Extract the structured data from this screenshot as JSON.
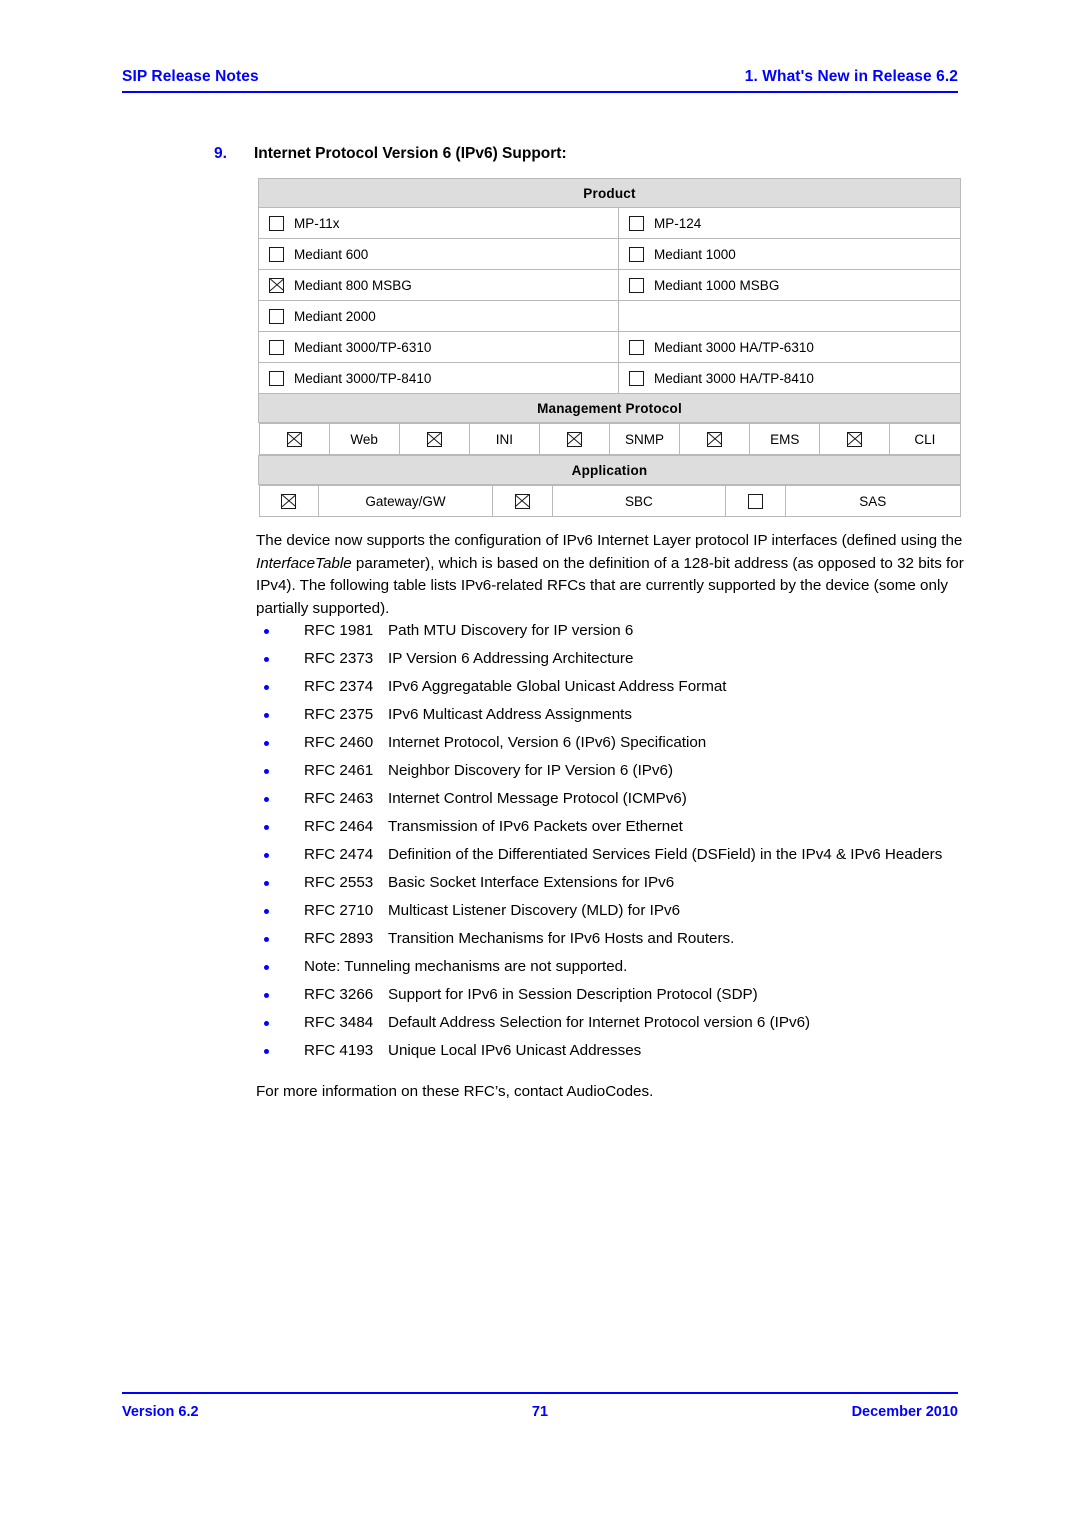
{
  "header": {
    "left": "SIP Release Notes",
    "right": "1. What's New in Release 6.2",
    "rule_color": "#0000FF"
  },
  "section": {
    "number": "9.",
    "title": "Internet Protocol Version 6 (IPv6) Support:",
    "number_color": "#0000FF"
  },
  "matrix": {
    "product": {
      "band_label": "Product",
      "rows": [
        {
          "left": {
            "label": "MP-11x",
            "checked": false
          },
          "right": {
            "label": "MP-124",
            "checked": false
          }
        },
        {
          "left": {
            "label": "Mediant 600",
            "checked": false
          },
          "right": {
            "label": "Mediant 1000",
            "checked": false
          }
        },
        {
          "left": {
            "label": "Mediant 800 MSBG",
            "checked": true
          },
          "right": {
            "label": "Mediant 1000 MSBG",
            "checked": false
          }
        },
        {
          "left": {
            "label": "Mediant 2000",
            "checked": false
          },
          "right": null
        },
        {
          "left": {
            "label": "Mediant 3000/TP-6310",
            "checked": false
          },
          "right": {
            "label": "Mediant 3000 HA/TP-6310",
            "checked": false
          }
        },
        {
          "left": {
            "label": "Mediant 3000/TP-8410",
            "checked": false
          },
          "right": {
            "label": "Mediant 3000 HA/TP-8410",
            "checked": false
          }
        }
      ]
    },
    "management_protocol": {
      "band_label": "Management Protocol",
      "items": [
        {
          "label": "Web",
          "checked": true
        },
        {
          "label": "INI",
          "checked": true
        },
        {
          "label": "SNMP",
          "checked": true
        },
        {
          "label": "EMS",
          "checked": true
        },
        {
          "label": "CLI",
          "checked": true
        }
      ]
    },
    "application": {
      "band_label": "Application",
      "items": [
        {
          "label": "Gateway/GW",
          "checked": true
        },
        {
          "label": "SBC",
          "checked": true
        },
        {
          "label": "SAS",
          "checked": false
        }
      ]
    }
  },
  "body": {
    "paragraph_part1": "The device now supports the configuration of IPv6 Internet Layer protocol IP interfaces (defined using the ",
    "paragraph_italic": "InterfaceTable",
    "paragraph_part2": " parameter), which is based on the definition of a 128-bit address (as opposed to 32 bits for IPv4). The following table lists IPv6-related RFCs that are currently supported by the device (some only partially supported).",
    "bullets": [
      {
        "rfc": "RFC 1981",
        "text": "Path MTU Discovery for IP version 6"
      },
      {
        "rfc": "RFC 2373",
        "text": "IP Version 6 Addressing Architecture"
      },
      {
        "rfc": "RFC 2374",
        "text": "IPv6 Aggregatable Global Unicast Address Format"
      },
      {
        "rfc": "RFC 2375",
        "text": "IPv6 Multicast Address Assignments"
      },
      {
        "rfc": "RFC 2460",
        "text": "Internet Protocol, Version 6 (IPv6) Specification"
      },
      {
        "rfc": "RFC 2461",
        "text": "Neighbor Discovery for IP Version 6 (IPv6)"
      },
      {
        "rfc": "RFC 2463",
        "text": "Internet Control Message Protocol (ICMPv6)"
      },
      {
        "rfc": "RFC 2464",
        "text": "Transmission of IPv6 Packets over Ethernet"
      },
      {
        "rfc": "RFC 2474",
        "text": "Definition of the Differentiated Services Field (DSField) in the IPv4 & IPv6 Headers"
      },
      {
        "rfc": "RFC 2553",
        "text": "Basic Socket Interface Extensions for IPv6"
      },
      {
        "rfc": "RFC 2710",
        "text": "Multicast Listener Discovery (MLD) for IPv6"
      },
      {
        "rfc": "RFC 2893",
        "text": "Transition Mechanisms for IPv6 Hosts and Routers."
      },
      {
        "rfc": "",
        "text": "Note: Tunneling mechanisms are not supported."
      },
      {
        "rfc": "RFC 3266",
        "text": "Support for IPv6 in Session Description Protocol (SDP)"
      },
      {
        "rfc": "RFC 3484",
        "text": "Default Address Selection for Internet Protocol version 6 (IPv6)"
      },
      {
        "rfc": "RFC 4193",
        "text": "Unique Local IPv6 Unicast Addresses"
      }
    ],
    "bullet_color": "#0000FF",
    "closing": "For more information on these RFC’s, contact AudioCodes."
  },
  "footer": {
    "left": "Version 6.2",
    "center": "71",
    "right": "December 2010",
    "rule_color": "#0000FF"
  }
}
